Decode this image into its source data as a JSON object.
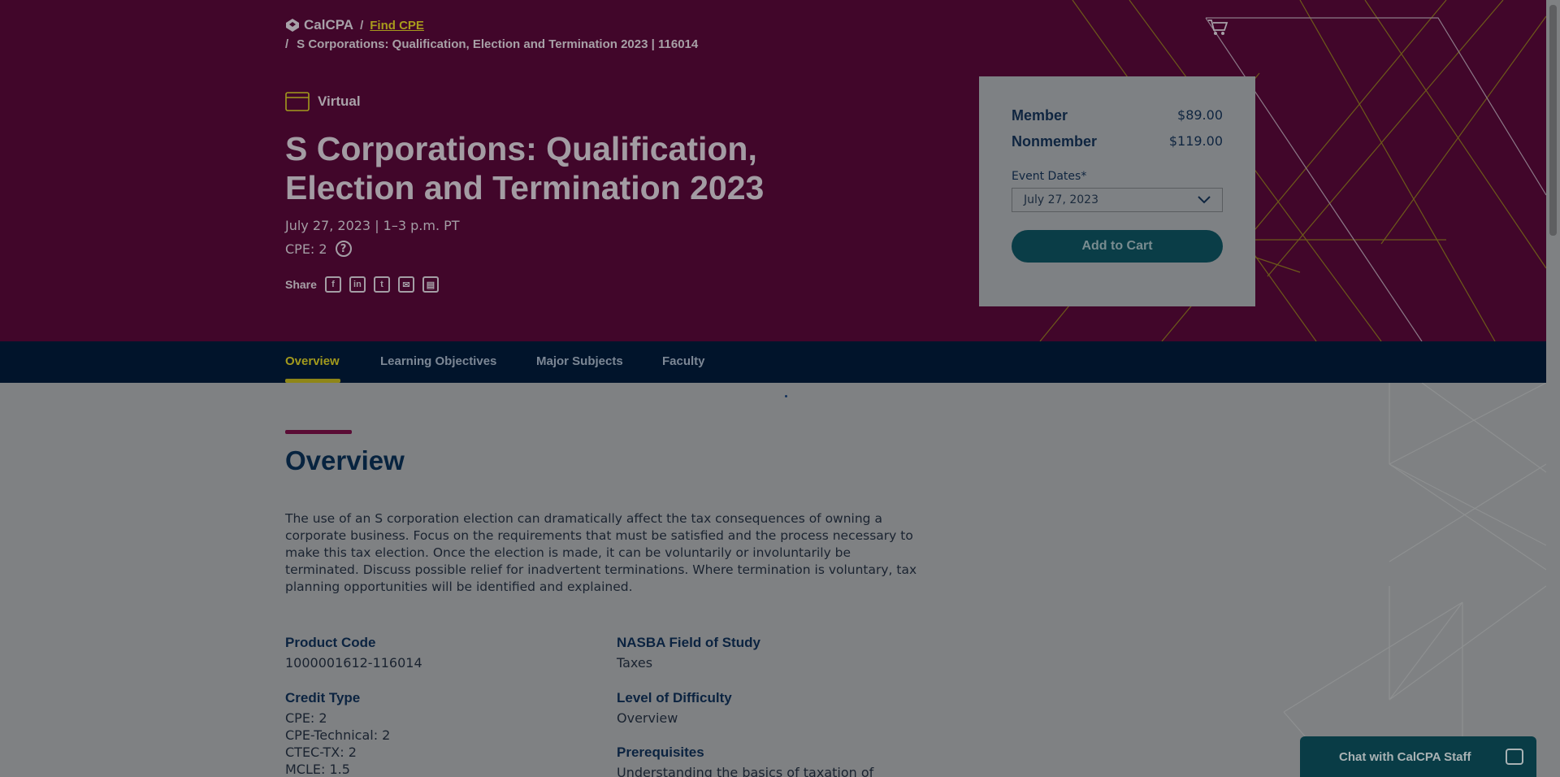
{
  "breadcrumb": {
    "home": "CalCPA",
    "separator": "/",
    "link": "Find CPE",
    "current": "S Corporations: Qualification, Election and Termination 2023 | 116014"
  },
  "course": {
    "format": "Virtual",
    "title": "S Corporations: Qualification, Election and Termination 2023",
    "date_time": "July 27, 2023 | 1–3 p.m. PT",
    "cpe": "CPE: 2",
    "share_label": "Share"
  },
  "share_icons": [
    "facebook-icon",
    "linkedin-icon",
    "twitter-icon",
    "email-icon",
    "calendar-icon"
  ],
  "pricing": {
    "member_label": "Member",
    "member_price": "$89.00",
    "nonmember_label": "Nonmember",
    "nonmember_price": "$119.00",
    "event_dates_label": "Event Dates*",
    "event_date_selected": "July 27, 2023",
    "add_to_cart": "Add to Cart"
  },
  "tabs": [
    "Overview",
    "Learning Objectives",
    "Major Subjects",
    "Faculty"
  ],
  "active_tab": "Overview",
  "overview": {
    "heading": "Overview",
    "description": "The use of an S corporation election can dramatically affect the tax consequences of owning a corporate business. Focus on the requirements that must be satisfied and the process necessary to make this tax election. Once the election is made, it can be voluntarily or involuntarily be terminated. Discuss possible relief for inadvertent terminations. Where termination is voluntary, tax planning opportunities will be identified and explained.",
    "product_code_label": "Product Code",
    "product_code": "1000001612-116014",
    "credit_type_label": "Credit Type",
    "credit_types": [
      "CPE: 2",
      "CPE-Technical: 2",
      "CTEC-TX: 2",
      "MCLE: 1.5"
    ],
    "field_of_study_label": "NASBA Field of Study",
    "field_of_study": "Taxes",
    "difficulty_label": "Level of Difficulty",
    "difficulty": "Overview",
    "prerequisites_label": "Prerequisites",
    "prerequisites": "Understanding the basics of taxation of"
  },
  "chat": {
    "label": "Chat with CalCPA Staff"
  },
  "colors": {
    "hero_bg": "#41062a",
    "nav_bg": "#01142b",
    "accent_gold": "#a29a1d",
    "button_teal": "#0a3d47"
  }
}
